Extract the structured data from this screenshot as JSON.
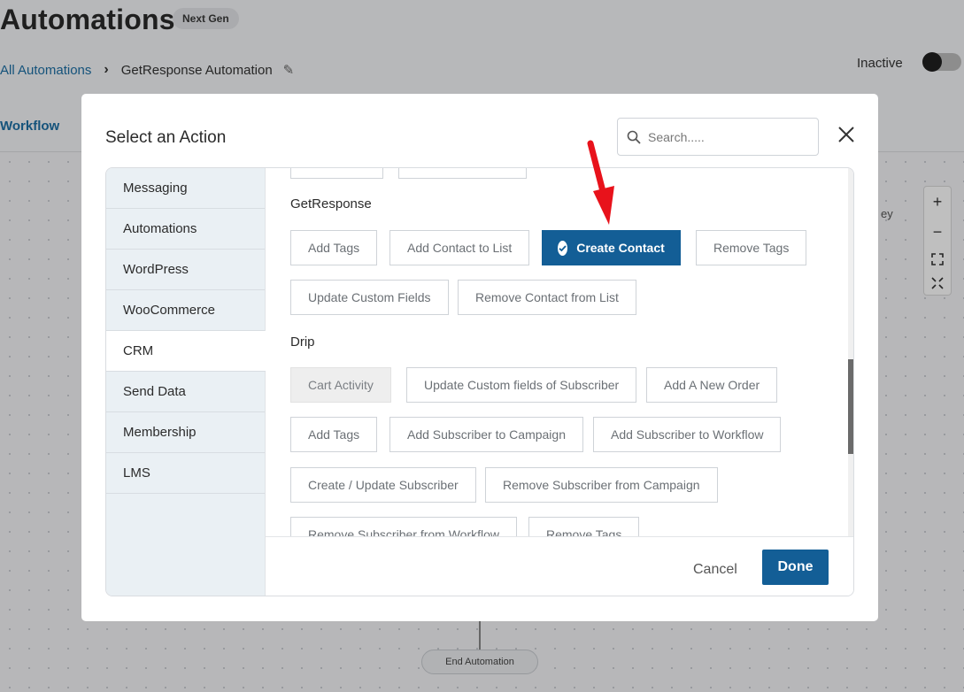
{
  "page": {
    "title": "Automations",
    "badge": "Next Gen",
    "breadcrumb": {
      "root": "All Automations",
      "current": "GetResponse Automation"
    },
    "status_label": "Inactive",
    "active_tab": "Workflow",
    "side_text": "ey",
    "end_node": "End Automation",
    "zoom": {
      "in": "+",
      "out": "−"
    }
  },
  "modal": {
    "title": "Select an Action",
    "search_placeholder": "Search.....",
    "categories": [
      {
        "label": "Messaging"
      },
      {
        "label": "Automations"
      },
      {
        "label": "WordPress"
      },
      {
        "label": "WooCommerce"
      },
      {
        "label": "CRM",
        "active": true
      },
      {
        "label": "Send Data"
      },
      {
        "label": "Membership"
      },
      {
        "label": "LMS"
      }
    ],
    "sections": {
      "getresponse": {
        "title": "GetResponse",
        "actions": [
          "Add Tags",
          "Add Contact to List",
          "Create Contact",
          "Remove Tags",
          "Update Custom Fields",
          "Remove Contact from List"
        ],
        "selected": "Create Contact"
      },
      "drip": {
        "title": "Drip",
        "actions": [
          "Cart Activity",
          "Update Custom fields of Subscriber",
          "Add A New Order",
          "Add Tags",
          "Add Subscriber to Campaign",
          "Add Subscriber to Workflow",
          "Create / Update Subscriber",
          "Remove Subscriber from Campaign",
          "Remove Subscriber from Workflow",
          "Remove Tags"
        ],
        "disabled": "Cart Activity"
      }
    },
    "footer": {
      "cancel": "Cancel",
      "done": "Done"
    }
  },
  "colors": {
    "primary": "#135e96",
    "link": "#1d6fa5",
    "annotation": "#e8121b",
    "sidebar_bg": "#eaf0f4"
  }
}
